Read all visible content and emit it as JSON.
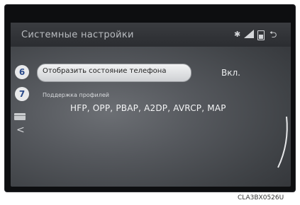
{
  "header": {
    "title": "Системные настройки",
    "status_icons": [
      "bluetooth-icon",
      "signal-icon",
      "battery-icon"
    ],
    "back_icon": "back-arrow-icon"
  },
  "items": [
    {
      "index": "6",
      "label": "Отобразить состояние телефона",
      "value": "Вкл."
    },
    {
      "index": "7",
      "label": "Поддержка профилей",
      "value": "HFP, OPP, PBAP, A2DP, AVRCP, MAP"
    }
  ],
  "side": {
    "icon": "list-icon",
    "chevron": "<"
  },
  "caption": "CLA3BX0526U",
  "colors": {
    "screen": "#55585d",
    "badge": "#e8e9eb",
    "badge_text": "#2a4a8a"
  }
}
